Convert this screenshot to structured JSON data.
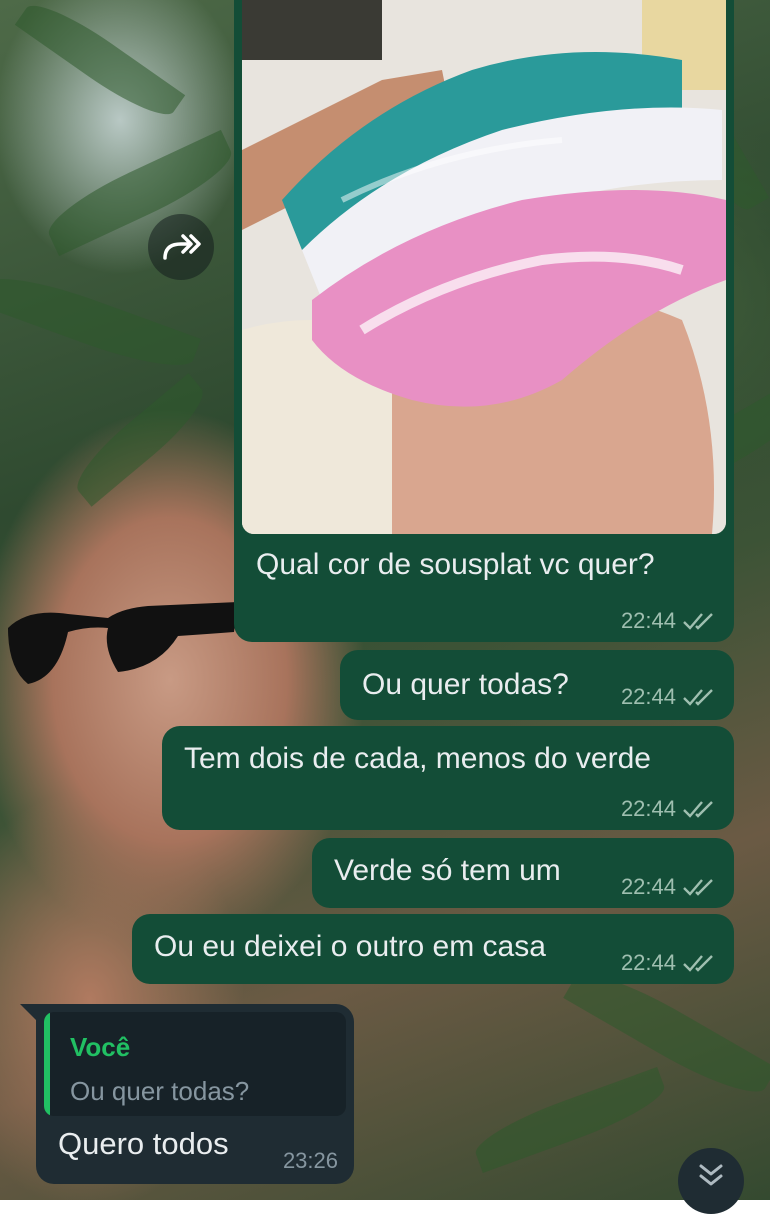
{
  "colors": {
    "outgoing_bubble": "#134d37",
    "incoming_bubble": "#1f2c33",
    "quote_accent": "#21c063",
    "read_ticks": "#9fbfb0"
  },
  "media_message": {
    "image_description_icon": "crochet-placemats-photo",
    "caption": "Qual cor de sousplat vc quer?",
    "time": "22:44",
    "status_icon": "double-check-icon"
  },
  "outgoing_messages": [
    {
      "text": "Ou quer todas?",
      "time": "22:44"
    },
    {
      "text": "Tem dois de cada, menos do verde",
      "time": "22:44"
    },
    {
      "text": "Verde só tem um",
      "time": "22:44"
    },
    {
      "text": "Ou eu deixei o outro em casa",
      "time": "22:44"
    }
  ],
  "incoming_message": {
    "quote_author": "Você",
    "quote_text": "Ou quer todas?",
    "text": "Quero todos",
    "time": "23:26"
  },
  "icons": {
    "forward": "forward-icon",
    "scroll_down": "double-chevron-down-icon"
  }
}
